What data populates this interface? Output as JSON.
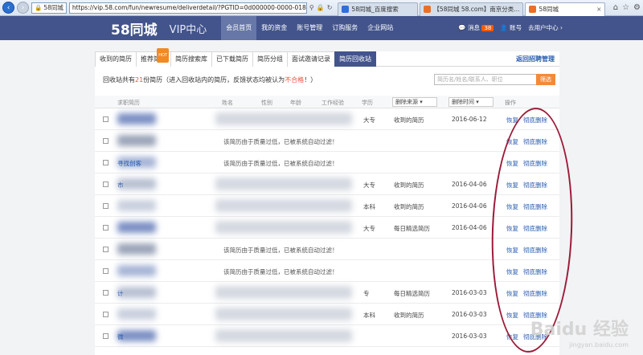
{
  "browser": {
    "site_chip": "58同城",
    "url": "https://vip.58.com/fun/newresume/deliverdetail/?PGTID=0d000000-0000-018c-7f",
    "tabs": [
      {
        "label": "58同城_百度搜索",
        "active": false
      },
      {
        "label": "【58同城 58.com】南京分类...",
        "active": false
      },
      {
        "label": "58同城",
        "active": true
      }
    ]
  },
  "header": {
    "logo": "58同城",
    "section": "VIP中心",
    "nav": [
      "会员首页",
      "我的资金",
      "账号管理",
      "订购服务",
      "企业网站"
    ],
    "messages_label": "消息",
    "messages_count": "38",
    "account_label": "账号",
    "user_center": "去用户中心 ›"
  },
  "subtabs": [
    {
      "label": "收到的简历",
      "active": false
    },
    {
      "label": "推荐简历",
      "active": false,
      "hot": "HOT"
    },
    {
      "label": "简历搜索库",
      "active": false
    },
    {
      "label": "已下载简历",
      "active": false
    },
    {
      "label": "简历分组",
      "active": false
    },
    {
      "label": "面试邀请记录",
      "active": false
    },
    {
      "label": "简历回收站",
      "active": true
    }
  ],
  "back_link": "返回招聘管理",
  "notice": {
    "prefix": "回收站共有",
    "count": "21",
    "middle": "份简历（进入回收站内的简历，反馈状态均被认为",
    "red": "不合格",
    "suffix": "！）"
  },
  "search": {
    "placeholder": "简历名/姓名/联系人、职位",
    "button": "筛选"
  },
  "table": {
    "headers": {
      "resume": "求职简历",
      "name": "姓名",
      "gender": "性别",
      "age": "年龄",
      "experience": "工作经验",
      "education": "学历",
      "action": "操作"
    },
    "filters": {
      "source": "删除来源",
      "time": "删除时间"
    },
    "rows": [
      {
        "name": "",
        "edu": "大专",
        "source": "收到的简历",
        "date": "2016-06-12",
        "msg": ""
      },
      {
        "name": "",
        "edu": "",
        "source": "",
        "date": "",
        "msg": "该简历由于质量过低，已被系统自动过滤！"
      },
      {
        "name": "寻找创客",
        "edu": "",
        "source": "",
        "date": "",
        "msg": "该简历由于质量过低，已被系统自动过滤！"
      },
      {
        "name": "市",
        "edu": "大专",
        "source": "收到的简历",
        "date": "2016-04-06",
        "msg": ""
      },
      {
        "name": "",
        "edu": "本科",
        "source": "收到的简历",
        "date": "2016-04-06",
        "msg": ""
      },
      {
        "name": "",
        "edu": "大专",
        "source": "每日精选简历",
        "date": "2016-04-06",
        "msg": ""
      },
      {
        "name": "",
        "edu": "",
        "source": "",
        "date": "",
        "msg": "该简历由于质量过低，已被系统自动过滤！"
      },
      {
        "name": "",
        "edu": "",
        "source": "",
        "date": "",
        "msg": "该简历由于质量过低，已被系统自动过滤！"
      },
      {
        "name": "计",
        "edu": "专",
        "source": "每日精选简历",
        "date": "2016-03-03",
        "msg": ""
      },
      {
        "name": "",
        "edu": "本科",
        "source": "收到的简历",
        "date": "2016-03-03",
        "msg": ""
      },
      {
        "name": "微",
        "edu": "",
        "source": "",
        "date": "2016-03-03",
        "msg": ""
      }
    ],
    "action_restore": "恢复",
    "action_delete": "彻底删除"
  },
  "watermark": {
    "brand": "Baidu 经验",
    "sub": "jingyan.baidu.com"
  }
}
